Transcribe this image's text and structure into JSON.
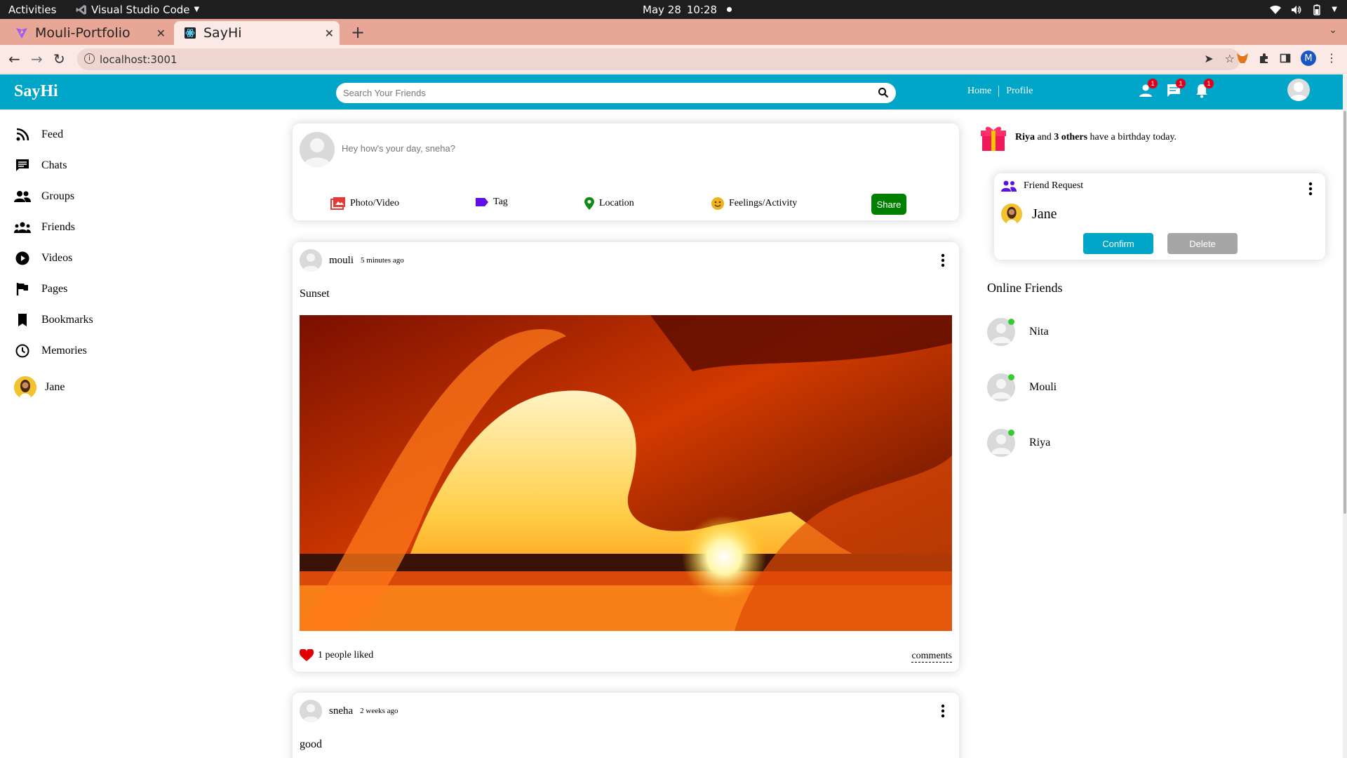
{
  "os": {
    "activities": "Activities",
    "app_name": "Visual Studio Code",
    "date": "May 28",
    "time": "10:28"
  },
  "browser": {
    "tabs": [
      {
        "label": "Mouli-Portfolio",
        "active": false
      },
      {
        "label": "SayHi",
        "active": true
      }
    ],
    "url": "localhost:3001",
    "profile_initial": "M"
  },
  "header": {
    "logo": "SayHi",
    "search_placeholder": "Search Your Friends",
    "nav": [
      "Home",
      "Profile"
    ],
    "badges": {
      "friends": "1",
      "chats": "1",
      "notifications": "1"
    },
    "accent": "#00a5c8"
  },
  "sidebar": {
    "items": [
      {
        "label": "Feed",
        "icon": "rss-feed-icon"
      },
      {
        "label": "Chats",
        "icon": "chat-icon"
      },
      {
        "label": "Groups",
        "icon": "group-icon"
      },
      {
        "label": "Friends",
        "icon": "friends-icon"
      },
      {
        "label": "Videos",
        "icon": "play-circle-icon"
      },
      {
        "label": "Pages",
        "icon": "flag-icon"
      },
      {
        "label": "Bookmarks",
        "icon": "bookmark-icon"
      },
      {
        "label": "Memories",
        "icon": "clock-icon"
      }
    ],
    "user": "Jane"
  },
  "share": {
    "placeholder": "Hey how's your day, sneha?",
    "options": [
      "Photo/Video",
      "Tag",
      "Location",
      "Feelings/Activity"
    ],
    "button": "Share"
  },
  "posts": [
    {
      "user": "mouli",
      "time": "5 minutes ago",
      "text": "Sunset",
      "likes": "1 people liked",
      "comments": "comments"
    },
    {
      "user": "sneha",
      "time": "2 weeks ago",
      "text": "good"
    }
  ],
  "rightbar": {
    "birthday": {
      "name": "Riya",
      "mid": " and ",
      "others": "3 others",
      "tail": " have a birthday today."
    },
    "friend_request": {
      "title": "Friend Request",
      "name": "Jane",
      "confirm": "Confirm",
      "delete": "Delete"
    },
    "online_title": "Online Friends",
    "online": [
      "Nita",
      "Mouli",
      "Riya"
    ]
  }
}
